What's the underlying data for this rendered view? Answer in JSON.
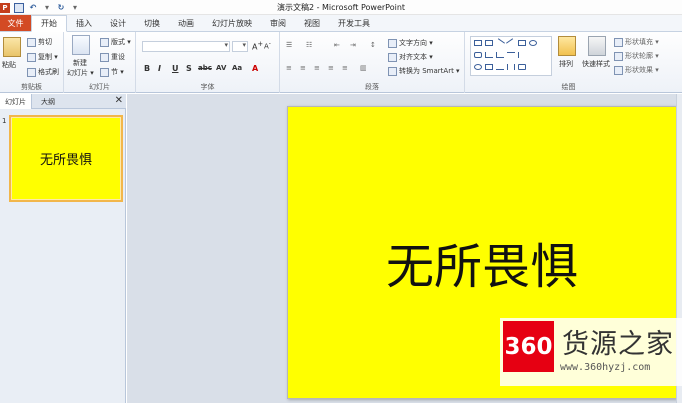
{
  "titlebar": {
    "title": "演示文稿2 - Microsoft PowerPoint",
    "app_icon": "P"
  },
  "tabs": [
    "文件",
    "开始",
    "插入",
    "设计",
    "切换",
    "动画",
    "幻灯片放映",
    "审阅",
    "视图",
    "开发工具"
  ],
  "ribbon": {
    "clipboard": {
      "label": "剪贴板",
      "paste": "粘贴",
      "cut": "剪切",
      "copy": "复制 ▾",
      "format_painter": "格式刷"
    },
    "slides": {
      "label": "幻灯片",
      "new_slide": "新建",
      "new_slide2": "幻灯片 ▾",
      "layout": "版式 ▾",
      "reset": "重设",
      "section": "节 ▾"
    },
    "font": {
      "label": "字体"
    },
    "paragraph": {
      "label": "段落",
      "text_direction": "文字方向 ▾",
      "align_text": "对齐文本 ▾",
      "smartart": "转换为 SmartArt ▾"
    },
    "drawing": {
      "label": "绘图",
      "arrange": "排列",
      "quick_styles": "快速样式",
      "shape_fill": "形状填充 ▾",
      "shape_outline": "形状轮廓 ▾",
      "shape_effects": "形状效果 ▾"
    }
  },
  "left_pane": {
    "tab_slides": "幻灯片",
    "tab_outline": "大纲",
    "close": "✕",
    "slide_number": "1",
    "thumb_text": "无所畏惧"
  },
  "slide": {
    "text": "无所畏惧",
    "background": "#ffff00"
  },
  "watermark": {
    "logo": "360",
    "name": "货源之家",
    "url": "www.360hyzj.com"
  }
}
